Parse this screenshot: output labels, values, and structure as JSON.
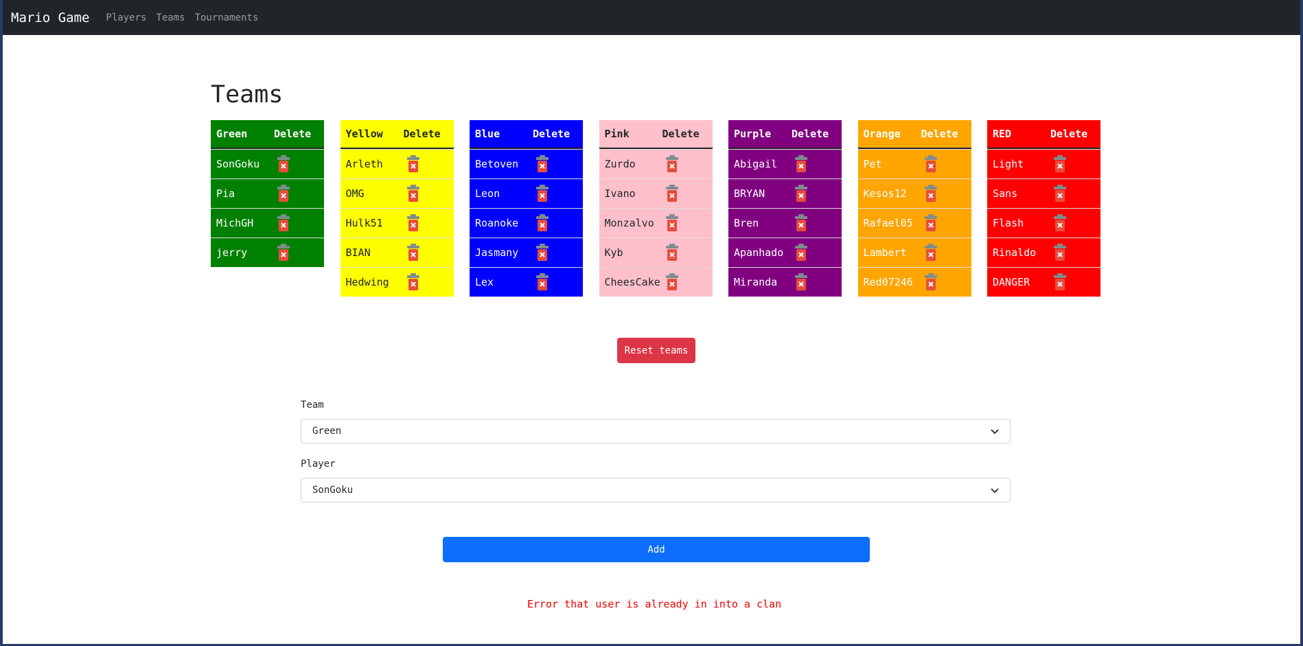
{
  "nav": {
    "brand": "Mario Game",
    "links": [
      "Players",
      "Teams",
      "Tournaments"
    ]
  },
  "page_title": "Teams",
  "delete_label": "Delete",
  "teams": [
    {
      "name": "Green",
      "bg": "#008000",
      "fg": "#ffffff",
      "players": [
        "SonGoku",
        "Pia",
        "MichGH",
        "jerry"
      ]
    },
    {
      "name": "Yellow",
      "bg": "#ffff00",
      "fg": "#212529",
      "players": [
        "Arleth",
        "OMG",
        "Hulk51",
        "BIAN",
        "Hedwing"
      ]
    },
    {
      "name": "Blue",
      "bg": "#0000ff",
      "fg": "#ffffff",
      "players": [
        "Betoven",
        "Leon",
        "Roanoke",
        "Jasmany",
        "Lex"
      ]
    },
    {
      "name": "Pink",
      "bg": "#ffc0cb",
      "fg": "#212529",
      "players": [
        "Zurdo",
        "Ivano",
        "Monzalvo",
        "Kyb",
        "CheesCake"
      ]
    },
    {
      "name": "Purple",
      "bg": "#800080",
      "fg": "#ffffff",
      "players": [
        "Abigail",
        "BRYAN",
        "Bren",
        "Apanhado",
        "Miranda"
      ]
    },
    {
      "name": "Orange",
      "bg": "#ffa500",
      "fg": "#ffffff",
      "players": [
        "Pet",
        "Kesos12",
        "Rafael05",
        "Lambert",
        "Red07246"
      ]
    },
    {
      "name": "RED",
      "bg": "#ff0000",
      "fg": "#ffffff",
      "players": [
        "Light",
        "Sans",
        "Flash",
        "Rinaldo",
        "DANGER"
      ]
    }
  ],
  "reset_label": "Reset teams",
  "form": {
    "team_label": "Team",
    "team_value": "Green",
    "player_label": "Player",
    "player_value": "SonGoku",
    "add_label": "Add"
  },
  "error_message": "Error that user is already in into a clan"
}
